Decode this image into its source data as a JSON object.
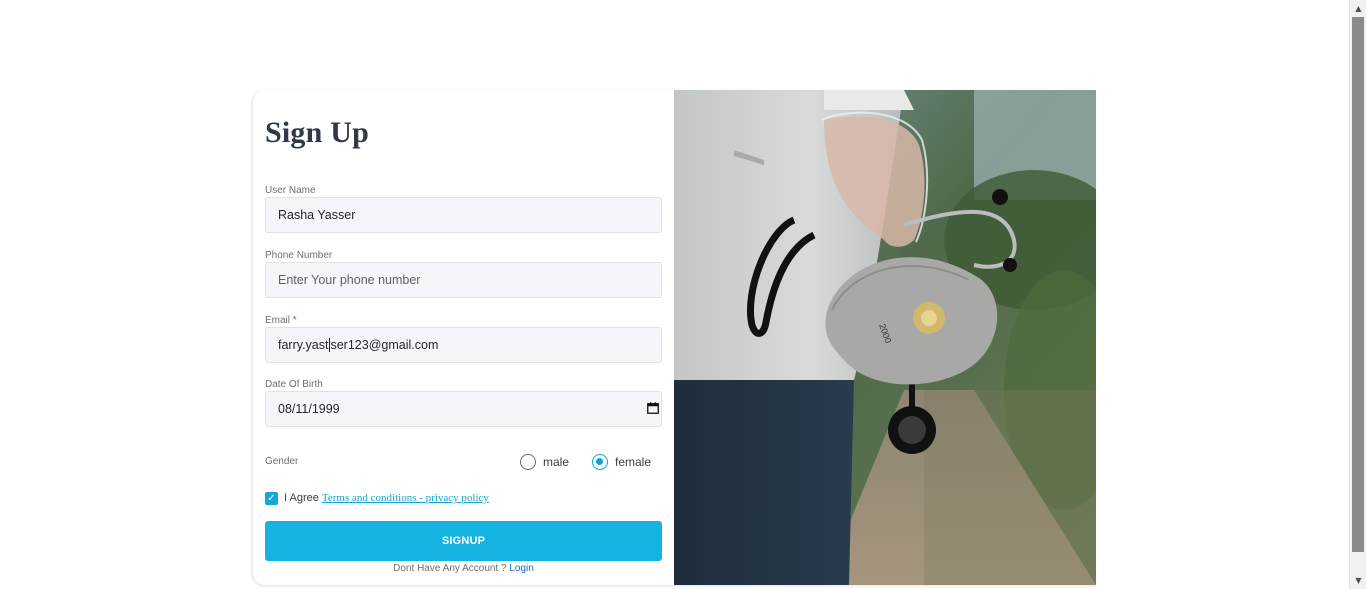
{
  "form": {
    "title": "Sign Up",
    "username": {
      "label": "User Name",
      "value": "Rasha Yasser"
    },
    "phone": {
      "label": "Phone Number",
      "placeholder": "Enter Your phone number"
    },
    "email": {
      "label": "Email",
      "required_mark": "*",
      "value_before_caret": "farry.yast",
      "value_after_caret": "ser123@gmail.com"
    },
    "dob": {
      "label": "Date Of Birth",
      "value": "08/11/1999"
    },
    "gender": {
      "label": "Gender",
      "options": [
        {
          "label": "male",
          "checked": false
        },
        {
          "label": "female",
          "checked": true
        }
      ]
    },
    "agree": {
      "prefix": "I Agree",
      "terms_link": "Terms and conditions",
      "separator": " - ",
      "privacy_link": "privacy policy",
      "checked": true
    },
    "submit_label": "SIGNUP",
    "account_prompt": "Dont Have Any Account ?",
    "login_link": "Login"
  },
  "colors": {
    "accent": "#14b3e0",
    "link": "#13a4cf",
    "login_link": "#1b6fc5",
    "title": "#2f3947"
  },
  "image": {
    "subject": "doctor holding face mask and stethoscope"
  }
}
